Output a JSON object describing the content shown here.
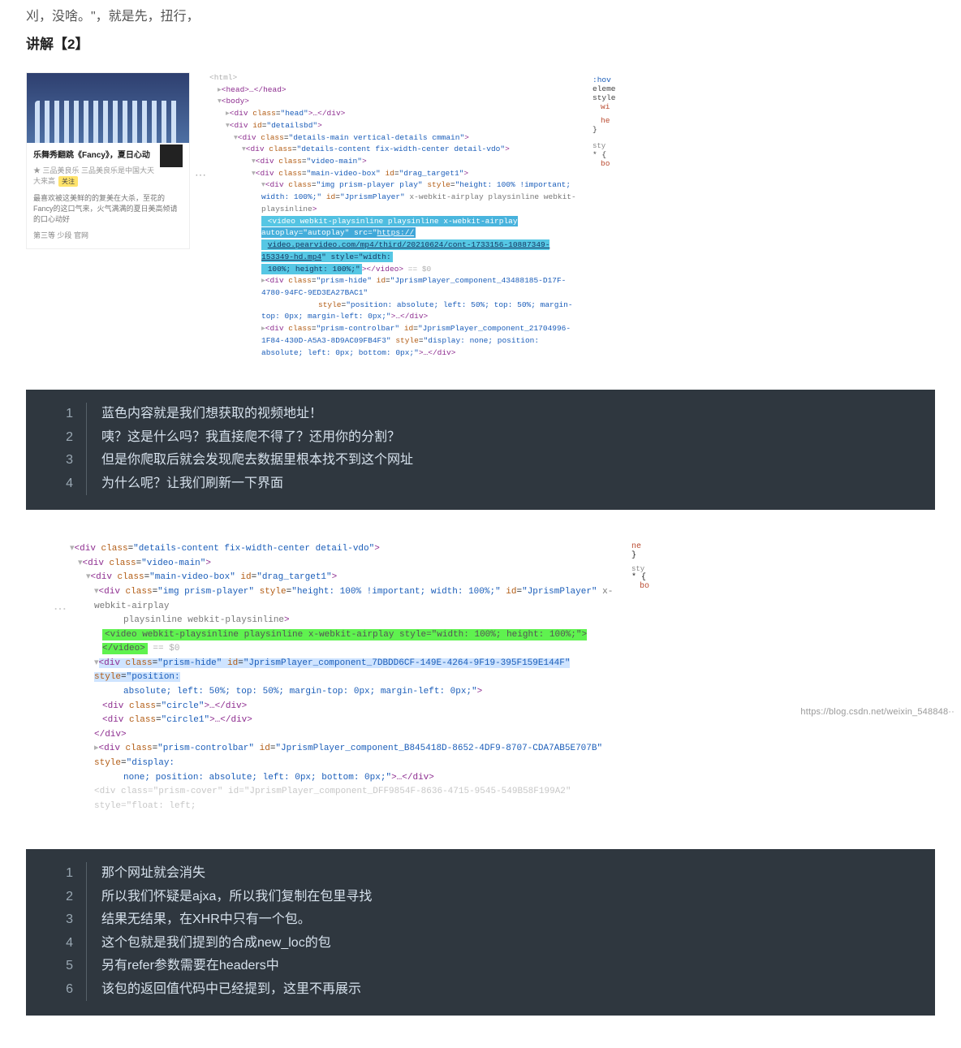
{
  "top_cut": "刈，没啥。\"，就是先，扭行，",
  "heading": "讲解【2】",
  "card": {
    "title": "乐舞秀翻跳《Fancy》，夏日心动",
    "meta": "★  三品美良乐  三品美良乐是中国大天大来高",
    "desc": "最喜欢被这美鲜的的复美在大杀，至花的Fancy的这口气来，火气满满的夏日美高倾请的口心动好",
    "link": "第三等  少段  官网"
  },
  "dom1": {
    "l0": "<html>",
    "l1": "<head>…</head>",
    "l2": "<body>",
    "l3": "<div class=\"head\">…</div>",
    "l4": "<div id=\"detailsbd\">",
    "l5": "<div class=\"details-main vertical-details cmmain\">",
    "l6": "<div class=\"details-content fix-width-center detail-vdo\">",
    "l7": "<div class=\"video-main\">",
    "l8": "<div class=\"main-video-box\" id=\"drag_target1\">",
    "l9": "<div class=\"img prism-player play\" style=\"height: 100% !important; width: 100%;\" id=\"JprismPlayer\" x-webkit-airplay playsinline webkit-playsinline>",
    "l10": "<video webkit-playsinline playsinline x-webkit-airplay autoplay=\"autoplay\" src=\"https://video.pearvideo.com/mp4/third/20210624/cont-1733156-10887349-153349-hd.mp4\" style=\"width: 100%; height: 100%;\"></video> == $0",
    "l11": "<div class=\"prism-hide\" id=\"JprismPlayer_component_43488185-D17F-4780-94FC-9ED3EA27BAC1\" style=\"position: absolute; left: 50%; top: 50%; margin-top: 0px; margin-left: 0px;\">…</div>",
    "l12": "<div class=\"prism-controlbar\" id=\"JprismPlayer_component_21704996-1F84-430D-A5A3-8D9AC09FB4F3\" style=\"display: none; position: absolute; left: 0px; bottom: 0px;\">…</div>"
  },
  "side1": {
    "a": ":hov",
    "b": "eleme",
    "c": "style",
    "d": "wi",
    "e": "he",
    "f": "}",
    "g": "sty",
    "h": "* {",
    "i": "bo"
  },
  "block1": [
    "蓝色内容就是我们想获取的视频地址！",
    "咦？这是什么吗？我直接爬不得了？还用你的分割？",
    "但是你爬取后就会发现爬去数据里根本找不到这个网址",
    "为什么呢？让我们刷新一下界面"
  ],
  "dom2": {
    "l1": "<div class=\"details-content fix-width-center detail-vdo\">",
    "l2": "<div class=\"video-main\">",
    "l3": "<div class=\"main-video-box\" id=\"drag_target1\">",
    "l4": "<div class=\"img prism-player\" style=\"height: 100% !important; width: 100%;\" id=\"JprismPlayer\" x-webkit-airplay playsinline webkit-playsinline>",
    "l5": "<video webkit-playsinline playsinline x-webkit-airplay style=\"width: 100%; height: 100%;\"></video> == $0",
    "l6": "<div class=\"prism-hide\" id=\"JprismPlayer_component_7DBDD6CF-149E-4264-9F19-395F159E144F\" style=\"position: absolute; left: 50%; top: 50%; margin-top: 0px; margin-left: 0px;\">",
    "l7": "<div class=\"circle\">…</div>",
    "l8": "<div class=\"circle1\">…</div>",
    "l9": "</div>",
    "l10": "<div class=\"prism-controlbar\" id=\"JprismPlayer_component_B845418D-8652-4DF9-8707-CDA7AB5E707B\" style=\"display: none; position: absolute; left: 0px; bottom: 0px;\">…</div>",
    "l11": "<div class=\"prism-cover\" id=\"JprismPlayer_component_DFF9854F-8636-4715-9545-549B58F199A2\" style=\"float: left;"
  },
  "side2": {
    "a": "ne",
    "b": "}",
    "c": "sty",
    "d": "* {",
    "e": "bo"
  },
  "block2": [
    "那个网址就会消失",
    "所以我们怀疑是ajxa，所以我们复制在包里寻找",
    "结果无结果，在XHR中只有一个包。",
    "这个包就是我们提到的合成new_loc的包",
    "另有refer参数需要在headers中",
    "该包的返回值代码中已经提到，这里不再展示"
  ],
  "footer": "https://blog.csdn.net/weixin_548848··"
}
